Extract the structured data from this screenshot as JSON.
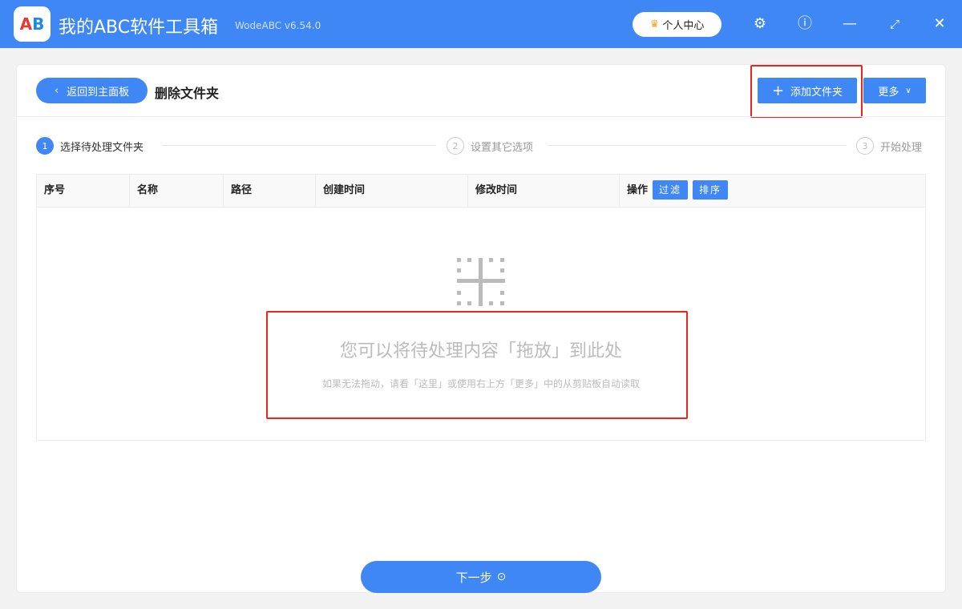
{
  "titlebar": {
    "logo_text": "AB",
    "app_title": "我的ABC软件工具箱",
    "version": "WodeABC v6.54.0",
    "user_center": "个人中心"
  },
  "header": {
    "back_label": "返回到主面板",
    "page_title": "删除文件夹",
    "add_folder": "添加文件夹",
    "more": "更多"
  },
  "steps": [
    {
      "num": "1",
      "label": "选择待处理文件夹"
    },
    {
      "num": "2",
      "label": "设置其它选项"
    },
    {
      "num": "3",
      "label": "开始处理"
    }
  ],
  "table": {
    "columns": [
      "序号",
      "名称",
      "路径",
      "创建时间",
      "修改时间",
      "操作"
    ],
    "filter": "过滤",
    "sort": "排序"
  },
  "drop": {
    "title": "您可以将待处理内容「拖放」到此处",
    "hint": "如果无法拖动，请看「这里」或使用右上方「更多」中的从剪贴板自动读取"
  },
  "footer": {
    "next": "下一步"
  }
}
